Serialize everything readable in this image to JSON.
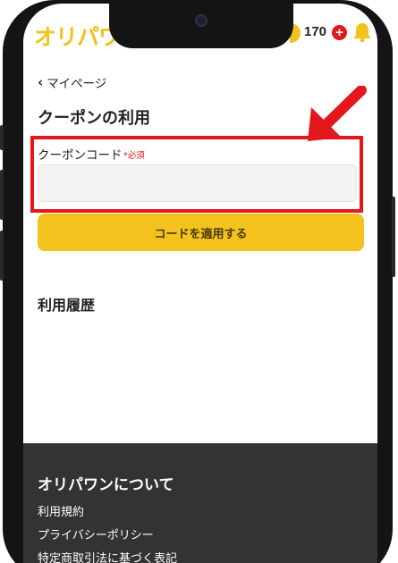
{
  "header": {
    "logo_text": "オリパワン",
    "points": "170",
    "add_points_symbol": "+",
    "accent_color": "#f3c21c"
  },
  "nav": {
    "back_label": "マイページ"
  },
  "page": {
    "title": "クーポンの利用"
  },
  "coupon_form": {
    "field_label": "クーポンコード",
    "required_mark": "*必須",
    "input_value": "",
    "input_placeholder": "",
    "submit_label": "コードを適用する"
  },
  "history": {
    "title": "利用履歴"
  },
  "footer": {
    "title": "オリパワンについて",
    "links": [
      "利用規約",
      "プライバシーポリシー",
      "特定商取引法に基づく表記"
    ]
  },
  "annotation": {
    "highlight_color": "#e3181d"
  }
}
